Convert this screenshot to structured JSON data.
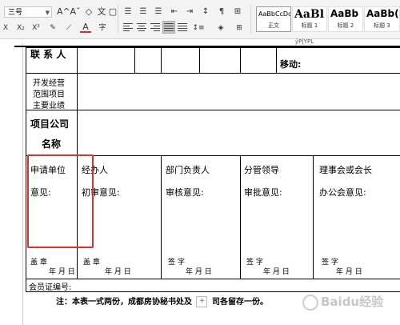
{
  "ribbon": {
    "font_size": "三号",
    "grow_font_icon": "A^",
    "shrink_font_icon": "Aˇ",
    "clear_format_icon": "◇",
    "pinyin_icon": "文",
    "strike_icon": "X",
    "sup_icon": "X²",
    "sub_icon": "X₂",
    "font_color_icon": "A",
    "border_char_icon": "字",
    "styles": [
      {
        "sample": "AaBbCcDd",
        "label": "正文"
      },
      {
        "sample": "AaBl",
        "label": "标题 1"
      },
      {
        "sample": "AaBb",
        "label": "标题 2"
      },
      {
        "sample": "AaBb(",
        "label": "标题 3"
      }
    ]
  },
  "document": {
    "top_fragment": "ÿP|YPL",
    "contact_label": "联  系  人",
    "mobile_label": "移动:",
    "business_label_1": "开发经营",
    "business_label_2": "范围项目",
    "business_label_3": "主要业绩",
    "project_company_label_1": "项目公司",
    "project_company_label_2": "名称",
    "approval_columns": [
      {
        "title": "申请单位",
        "subtitle": "意见:",
        "sign": "盖  章",
        "date": "年   月   日"
      },
      {
        "title": "经办人",
        "subtitle": "初审意见:",
        "sign": "盖  章",
        "date": "年   月   日"
      },
      {
        "title": "部门负责人",
        "subtitle": "审核意见:",
        "sign": "签  字",
        "date": "年   月   日"
      },
      {
        "title": "分管领导",
        "subtitle": "审批意见:",
        "sign": "签  字",
        "date": "年   月   日"
      },
      {
        "title": "理事会或会长",
        "subtitle": "办公会意见:",
        "sign": "签  字",
        "date": "年   月   日"
      }
    ],
    "member_no_label": "会员证编号:",
    "note_before": "注：本表一式两份，成都房协秘书处及",
    "note_plus": "+",
    "note_after": "司各留存一份。",
    "watermark": "Baidu经验"
  },
  "colors": {
    "highlight": "#d9322b",
    "ribbon_bg": "#f3f3f3"
  }
}
